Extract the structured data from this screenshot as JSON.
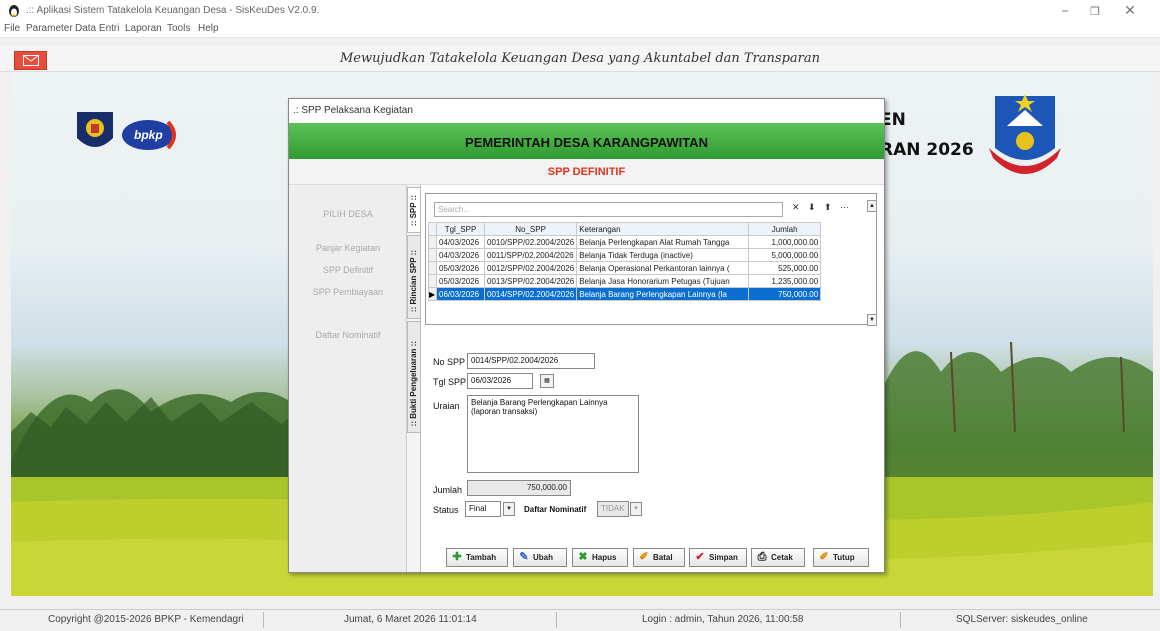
{
  "window": {
    "title": ".:: Aplikasi Sistem Tatakelola Keuangan Desa - SisKeuDes V2.0.9.",
    "minimize_icon": "minimize-icon",
    "maximize_icon": "maximize-icon",
    "close_icon": "close-icon"
  },
  "menu": [
    "File",
    "Parameter",
    "Data Entri",
    "Laporan",
    "Tools",
    "Help"
  ],
  "banner": {
    "motto": "Mewujudkan Tatakelola Keuangan Desa yang Akuntabel dan Transparan"
  },
  "header_right": {
    "line1": "EN",
    "line2": "RAN 2026"
  },
  "dialog": {
    "title": ".: SPP Pelaksana Kegiatan",
    "org": "PEMERINTAH DESA KARANGPAWITAN",
    "subtitle": "SPP DEFINITIF",
    "nav": [
      "PILIH DESA",
      "Panjar Kegiatan",
      "SPP Definitif",
      "SPP Pembiayaan",
      "Daftar Nominatif"
    ],
    "tabs": [
      ":: SPP ::",
      ":: Rincian SPP ::",
      ":: Bukti Pengeluaran ::"
    ],
    "search_placeholder": "Search...",
    "grid": {
      "columns": [
        "Tgl_SPP",
        "No_SPP",
        "Keterangan",
        "Jumlah"
      ],
      "rows": [
        [
          "04/03/2026",
          "0010/SPP/02.2004/2026",
          "Belanja Perlengkapan Alat Rumah Tangga",
          "1,000,000.00"
        ],
        [
          "04/03/2026",
          "0011/SPP/02.2004/2026",
          "Belanja Tidak Terduga (inactive)",
          "5,000,000.00"
        ],
        [
          "05/03/2026",
          "0012/SPP/02.2004/2026",
          "Belanja Operasional Perkantoran lainnya (",
          "525,000.00"
        ],
        [
          "05/03/2026",
          "0013/SPP/02.2004/2026",
          "Belanja Jasa Honorarium Petugas (Tujuan",
          "1,235,000.00"
        ],
        [
          "06/03/2026",
          "0014/SPP/02.2004/2026",
          "Belanja Barang Perlengkapan Lainnya (la",
          "750,000.00"
        ]
      ]
    },
    "form": {
      "no_spp_label": "No SPP",
      "no_spp_value": "0014/SPP/02.2004/2026",
      "tgl_spp_label": "Tgl SPP",
      "tgl_spp_value": "06/03/2026",
      "uraian_label": "Uraian",
      "uraian_value": "Belanja Barang Perlengkapan Lainnya\n(laporan transaksi)",
      "jumlah_label": "Jumlah",
      "jumlah_value": "750,000.00",
      "status_label": "Status",
      "status_value": "Final",
      "nominatif_label": "Daftar Nominatif",
      "nominatif_value": "TIDAK"
    },
    "buttons": {
      "tambah": "Tambah",
      "ubah": "Ubah",
      "hapus": "Hapus",
      "batal": "Batal",
      "simpan": "Simpan",
      "cetak": "Cetak",
      "tutup": "Tutup"
    }
  },
  "status": {
    "copyright": "Copyright @2015-2026 BPKP - Kemendagri",
    "datetime": "Jumat, 6 Maret 2026  11:01:14",
    "login": "Login : admin,  Tahun 2026, 11:00:58",
    "server": "SQLServer: siskeudes_online"
  },
  "logos": {
    "bpkp": "bpkp"
  },
  "colors": {
    "header_green": "#2f9a30",
    "subtitle_red": "#e0331c",
    "selection_blue": "#0a6fd1"
  }
}
